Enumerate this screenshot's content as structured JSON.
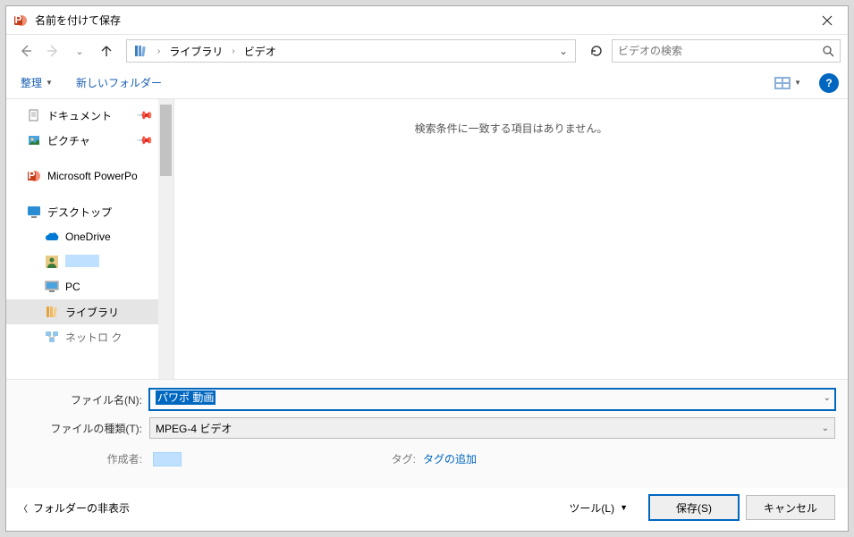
{
  "title": "名前を付けて保存",
  "breadcrumb": {
    "root_icon": "library-icon",
    "items": [
      "ライブラリ",
      "ビデオ"
    ]
  },
  "search": {
    "placeholder": "ビデオの検索"
  },
  "toolbar": {
    "organize": "整理",
    "new_folder": "新しいフォルダー"
  },
  "tree": {
    "items": [
      {
        "icon": "document-icon",
        "label": "ドキュメント",
        "pinned": true,
        "indent": 0
      },
      {
        "icon": "pictures-icon",
        "label": "ピクチャ",
        "pinned": true,
        "indent": 0
      },
      {
        "icon": "powerpoint-icon",
        "label": "Microsoft PowerPo",
        "indent": 0,
        "gap_before": true
      },
      {
        "icon": "desktop-icon",
        "label": "デスクトップ",
        "indent": 0,
        "gap_before": true
      },
      {
        "icon": "onedrive-icon",
        "label": "OneDrive",
        "indent": 1
      },
      {
        "icon": "user-icon",
        "label": "",
        "indent": 1,
        "redacted": true
      },
      {
        "icon": "pc-icon",
        "label": "PC",
        "indent": 1
      },
      {
        "icon": "library-icon",
        "label": "ライブラリ",
        "indent": 1,
        "selected": true
      },
      {
        "icon": "network-icon",
        "label": "ネットワーク",
        "indent": 1,
        "truncated": "ネットロ  ク"
      }
    ]
  },
  "content": {
    "empty_message": "検索条件に一致する項目はありません。"
  },
  "form": {
    "filename_label": "ファイル名(N):",
    "filename_value": "パワポ 動画",
    "filetype_label": "ファイルの種類(T):",
    "filetype_value": "MPEG-4 ビデオ",
    "author_label": "作成者:",
    "tags_label": "タグ:",
    "tags_value": "タグの追加"
  },
  "footer": {
    "hide_folders": "フォルダーの非表示",
    "tools": "ツール(L)",
    "save": "保存(S)",
    "cancel": "キャンセル"
  }
}
